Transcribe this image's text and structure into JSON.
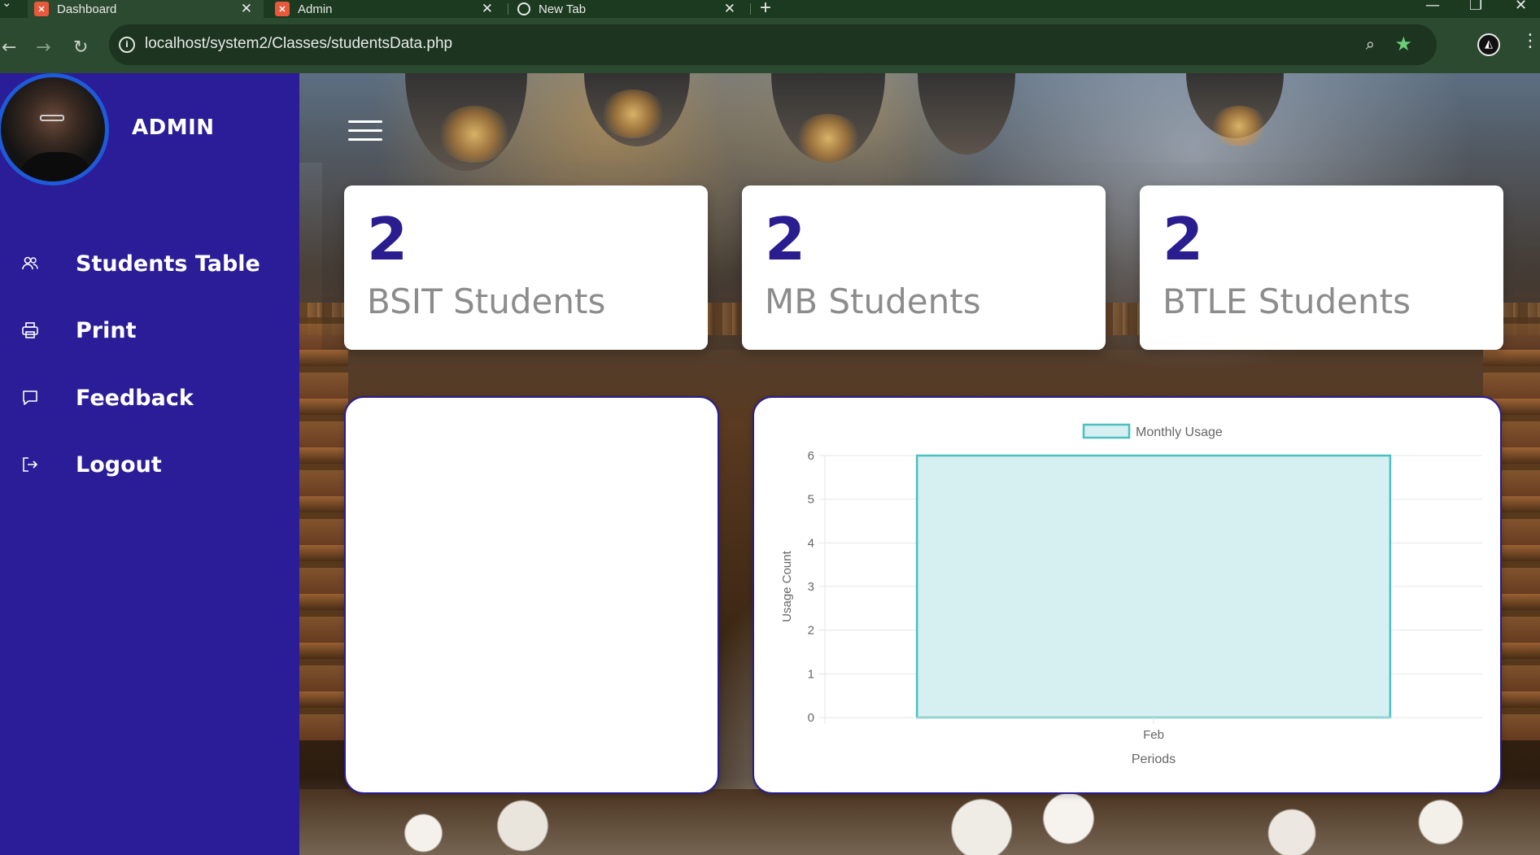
{
  "browser": {
    "tabs": [
      {
        "title": "Dashboard",
        "active": true,
        "favicon": "xampp-icon"
      },
      {
        "title": "Admin",
        "active": false,
        "favicon": "xampp-icon"
      },
      {
        "title": "New Tab",
        "active": false,
        "favicon": "chrome-icon"
      }
    ],
    "new_tab_label": "+",
    "url": "localhost/system2/Classes/studentsData.php"
  },
  "sidebar": {
    "admin_label": "ADMIN",
    "items": [
      {
        "label": "Students Table",
        "icon": "users-icon"
      },
      {
        "label": "Print",
        "icon": "printer-icon"
      },
      {
        "label": "Feedback",
        "icon": "chat-icon"
      },
      {
        "label": "Logout",
        "icon": "logout-icon"
      }
    ]
  },
  "stats": [
    {
      "count": "2",
      "label": "BSIT Students"
    },
    {
      "count": "2",
      "label": "MB Students"
    },
    {
      "count": "2",
      "label": "BTLE Students"
    }
  ],
  "colors": {
    "sidebar": "#2a1d97",
    "accent": "#2a1d8f",
    "bar_fill": "#d6eff0",
    "bar_border": "#4bc0c0"
  },
  "chart_data": {
    "type": "bar",
    "categories": [
      "Feb"
    ],
    "series": [
      {
        "name": "Monthly Usage",
        "values": [
          6
        ]
      }
    ],
    "xlabel": "Periods",
    "ylabel": "Usage Count",
    "ylim": [
      0,
      6
    ],
    "yticks": [
      "0",
      "1",
      "2",
      "3",
      "4",
      "5",
      "6"
    ],
    "grid": true,
    "legend": "top-center"
  }
}
